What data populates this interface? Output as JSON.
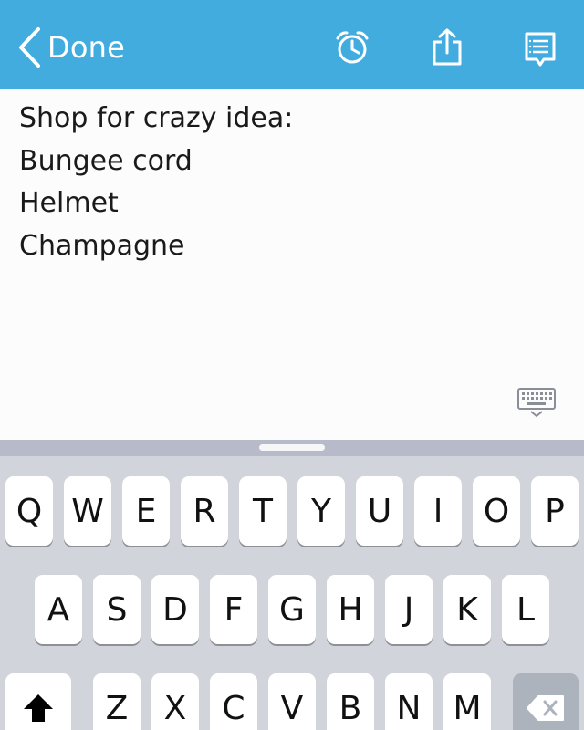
{
  "header": {
    "back_label": "Done",
    "icons": [
      "chevron-left-icon",
      "alarm-clock-icon",
      "share-icon",
      "notes-list-icon"
    ],
    "color": "#42acdf"
  },
  "note": {
    "lines": [
      "Shop for crazy idea:",
      "Bungee cord",
      "Helmet",
      "Champagne"
    ]
  },
  "keyboard": {
    "row1": [
      "Q",
      "W",
      "E",
      "R",
      "T",
      "Y",
      "U",
      "I",
      "O",
      "P"
    ],
    "row2": [
      "A",
      "S",
      "D",
      "F",
      "G",
      "H",
      "J",
      "K",
      "L"
    ],
    "row3": [
      "Z",
      "X",
      "C",
      "V",
      "B",
      "N",
      "M"
    ],
    "shift_icon": "shift-arrow-icon",
    "delete_icon": "backspace-icon",
    "dismiss_icon": "keyboard-dismiss-icon"
  }
}
